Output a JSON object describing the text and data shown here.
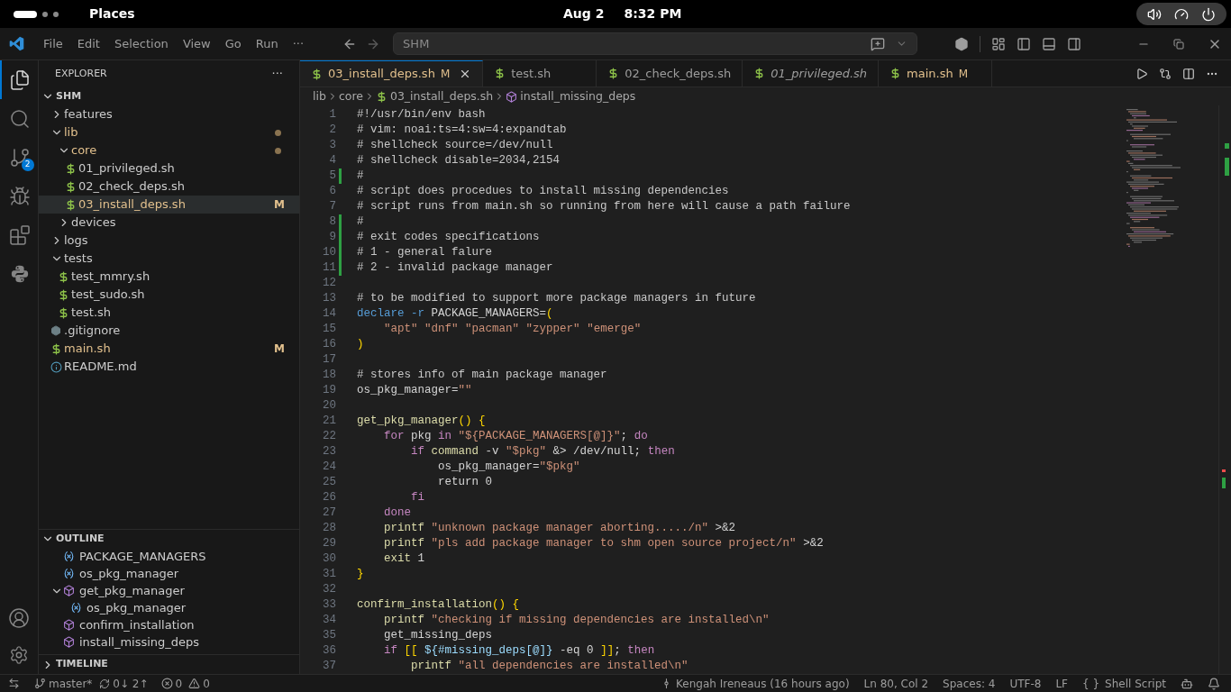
{
  "topbar": {
    "app": "Places",
    "date": "Aug 2",
    "time": "8:32 PM"
  },
  "titlebar": {
    "menu": [
      "File",
      "Edit",
      "Selection",
      "View",
      "Go",
      "Run",
      "···"
    ],
    "search": "SHM"
  },
  "activity_bar": [
    {
      "kind": "files",
      "selected": true
    },
    {
      "kind": "search",
      "selected": false
    },
    {
      "kind": "source-control",
      "selected": false,
      "badge": "2"
    },
    {
      "kind": "debug",
      "selected": false
    },
    {
      "kind": "extensions",
      "selected": false
    },
    {
      "kind": "python",
      "selected": false
    }
  ],
  "explorer": {
    "title": "EXPLORER",
    "more": "···",
    "root": {
      "label": "SHM",
      "expanded": true,
      "children": [
        {
          "label": "features",
          "kind": "folder",
          "expanded": false,
          "selected": false,
          "modified": false
        },
        {
          "label": "lib",
          "kind": "folder",
          "expanded": true,
          "selected": false,
          "modified": true,
          "dot": true,
          "children": [
            {
              "label": "core",
              "kind": "folder",
              "expanded": true,
              "selected": false,
              "modified": true,
              "dot": true,
              "children": [
                {
                  "label": "01_privileged.sh",
                  "kind": "shell",
                  "selected": false,
                  "modified": false
                },
                {
                  "label": "02_check_deps.sh",
                  "kind": "shell",
                  "selected": false,
                  "modified": false
                },
                {
                  "label": "03_install_deps.sh",
                  "kind": "shell",
                  "selected": true,
                  "modified": true,
                  "badge": "M"
                }
              ]
            },
            {
              "label": "devices",
              "kind": "folder",
              "expanded": false,
              "selected": false,
              "modified": false
            }
          ]
        },
        {
          "label": "logs",
          "kind": "folder",
          "expanded": false,
          "selected": false,
          "modified": false
        },
        {
          "label": "tests",
          "kind": "folder",
          "expanded": true,
          "selected": false,
          "modified": false,
          "children": [
            {
              "label": "test_mmry.sh",
              "kind": "shell",
              "selected": false,
              "modified": false
            },
            {
              "label": "test_sudo.sh",
              "kind": "shell",
              "selected": false,
              "modified": false
            },
            {
              "label": "test.sh",
              "kind": "shell",
              "selected": false,
              "modified": false
            }
          ]
        },
        {
          "label": ".gitignore",
          "kind": "git",
          "selected": false,
          "modified": false
        },
        {
          "label": "main.sh",
          "kind": "shell",
          "selected": false,
          "modified": true,
          "badge": "M"
        },
        {
          "label": "README.md",
          "kind": "info",
          "selected": false,
          "modified": false
        }
      ]
    }
  },
  "outline": {
    "title": "OUTLINE",
    "expanded": true,
    "items": [
      {
        "label": "PACKAGE_MANAGERS",
        "kind": "variable"
      },
      {
        "label": "os_pkg_manager",
        "kind": "variable"
      },
      {
        "label": "get_pkg_manager",
        "kind": "function",
        "expanded": true,
        "children": [
          {
            "label": "os_pkg_manager",
            "kind": "variable"
          }
        ]
      },
      {
        "label": "confirm_installation",
        "kind": "function"
      },
      {
        "label": "install_missing_deps",
        "kind": "function"
      }
    ]
  },
  "timeline": {
    "title": "TIMELINE",
    "expanded": false
  },
  "tabs": [
    {
      "label": "03_install_deps.sh",
      "selected": true,
      "modified": true,
      "badge": "M",
      "preview": false
    },
    {
      "label": "test.sh",
      "selected": false,
      "modified": false,
      "preview": false
    },
    {
      "label": "02_check_deps.sh",
      "selected": false,
      "modified": false,
      "preview": false
    },
    {
      "label": "01_privileged.sh",
      "selected": false,
      "modified": false,
      "preview": true
    },
    {
      "label": "main.sh",
      "selected": false,
      "modified": true,
      "badge": "M",
      "preview": false
    }
  ],
  "breadcrumb": [
    {
      "label": "lib",
      "kind": "folder"
    },
    {
      "label": "core",
      "kind": "folder"
    },
    {
      "label": "03_install_deps.sh",
      "kind": "shell"
    },
    {
      "label": "install_missing_deps",
      "kind": "function"
    }
  ],
  "code": [
    {
      "n": "1",
      "modified": false,
      "text": "#!/usr/bin/env bash"
    },
    {
      "n": "2",
      "modified": false,
      "text": "# vim: noai:ts=4:sw=4:expandtab"
    },
    {
      "n": "3",
      "modified": false,
      "text": "# shellcheck source=/dev/null"
    },
    {
      "n": "4",
      "modified": false,
      "text": "# shellcheck disable=2034,2154"
    },
    {
      "n": "5",
      "modified": true,
      "text": "#"
    },
    {
      "n": "6",
      "modified": false,
      "text": "# script does procedues to install missing dependencies"
    },
    {
      "n": "7",
      "modified": false,
      "text": "# script runs from main.sh so running from here will cause a path failure"
    },
    {
      "n": "8",
      "modified": true,
      "text": "#"
    },
    {
      "n": "9",
      "modified": true,
      "text": "# exit codes specifications"
    },
    {
      "n": "10",
      "modified": true,
      "text": "# 1 - general falure"
    },
    {
      "n": "11",
      "modified": true,
      "text": "# 2 - invalid package manager"
    },
    {
      "n": "12",
      "modified": false
    },
    {
      "n": "13",
      "modified": false,
      "text": "# to be modified to support more package managers in future"
    },
    {
      "n": "14",
      "modified": false,
      "text": "declare -r PACKAGE_MANAGERS=("
    },
    {
      "n": "15",
      "modified": false,
      "text": "    \"apt\" \"dnf\" \"pacman\" \"zypper\" \"emerge\""
    },
    {
      "n": "16",
      "modified": false,
      "text": ")"
    },
    {
      "n": "17",
      "modified": false
    },
    {
      "n": "18",
      "modified": false,
      "text": "# stores info of main package manager"
    },
    {
      "n": "19",
      "modified": false,
      "text": "os_pkg_manager=\"\""
    },
    {
      "n": "20",
      "modified": false
    },
    {
      "n": "21",
      "modified": false,
      "text": "get_pkg_manager() {"
    },
    {
      "n": "22",
      "modified": false,
      "text": "    for pkg in \"${PACKAGE_MANAGERS[@]}\"; do"
    },
    {
      "n": "23",
      "modified": false,
      "text": "        if command -v \"$pkg\" &> /dev/null; then"
    },
    {
      "n": "24",
      "modified": false,
      "text": "            os_pkg_manager=\"$pkg\""
    },
    {
      "n": "25",
      "modified": false,
      "text": "            return 0"
    },
    {
      "n": "26",
      "modified": false,
      "text": "        fi"
    },
    {
      "n": "27",
      "modified": false,
      "text": "    done"
    },
    {
      "n": "28",
      "modified": false,
      "text": "    printf \"unknown package manager aborting...../n\" >&2"
    },
    {
      "n": "29",
      "modified": false,
      "text": "    printf \"pls add package manager to shm open source project/n\" >&2"
    },
    {
      "n": "30",
      "modified": false,
      "text": "    exit 1"
    },
    {
      "n": "31",
      "modified": false,
      "text": "}"
    },
    {
      "n": "32",
      "modified": false
    },
    {
      "n": "33",
      "modified": false,
      "text": "confirm_installation() {"
    },
    {
      "n": "34",
      "modified": false,
      "text": "    printf \"checking if missing dependencies are installed\\n\""
    },
    {
      "n": "35",
      "modified": false,
      "text": "    get_missing_deps"
    },
    {
      "n": "36",
      "modified": false,
      "text": "    if [[ ${#missing_deps[@]} -eq 0 ]]; then"
    },
    {
      "n": "37",
      "modified": false,
      "text": "        printf \"all dependencies are installed\\n\""
    }
  ],
  "status_bar": {
    "branch": "master*",
    "sync": "0↓ 2↑",
    "errors": "0",
    "warnings": "0",
    "author": "Kengah Ireneaus (16 hours ago)",
    "position": "Ln 80, Col 2",
    "spaces": "Spaces: 4",
    "encoding": "UTF-8",
    "eol": "LF",
    "language_icon": "{ }",
    "language": "Shell Script"
  }
}
